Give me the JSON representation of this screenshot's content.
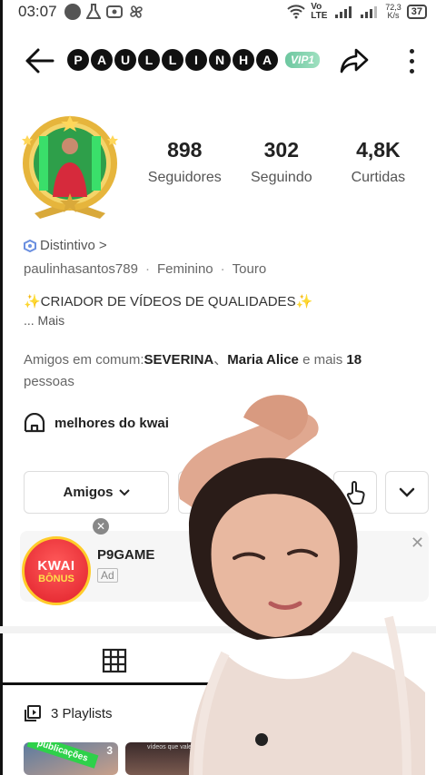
{
  "status": {
    "time": "03:07",
    "network": "Vo LTE",
    "speed_value": "72,3",
    "speed_unit": "K/s",
    "battery": "37"
  },
  "header": {
    "name_letters": [
      "P",
      "A",
      "U",
      "L",
      "L",
      "I",
      "N",
      "H",
      "A"
    ],
    "vip": "VIP1"
  },
  "stats": [
    {
      "value": "898",
      "label": "Seguidores"
    },
    {
      "value": "302",
      "label": "Seguindo"
    },
    {
      "value": "4,8K",
      "label": "Curtidas"
    }
  ],
  "profile": {
    "badge_label": "Distintivo",
    "badge_chevron": ">",
    "username": "paulinhasantos789",
    "gender": "Feminino",
    "sign": "Touro",
    "separator": "·",
    "bio": "✨CRIADOR DE VÍDEOS DE QUALIDADES✨",
    "bio_more": "... Mais",
    "mutual_prefix": "Amigos em comum:",
    "mutual_name1": "SEVERINA",
    "mutual_sep": "、",
    "mutual_name2": "Maria Alice",
    "mutual_middle": " e mais ",
    "mutual_count": "18",
    "mutual_suffix": " pessoas",
    "community": "melhores do kwai"
  },
  "actions": {
    "friends_button": "Amigos"
  },
  "ad": {
    "logo_line1": "KWAI",
    "logo_line2": "BÔNUS",
    "title": "P9GAME",
    "tag": "Ad",
    "close_top": "✕",
    "close": "✕"
  },
  "content": {
    "playlists": "3 Playlists",
    "thumb1_ribbon": "publicações",
    "thumb1_count": "3",
    "thumb2_caption": "vídeos que valem"
  }
}
